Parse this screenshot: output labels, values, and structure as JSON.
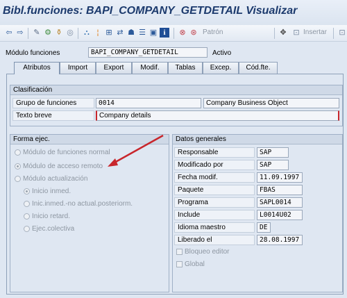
{
  "window": {
    "title": "Bibl.funciones: BAPI_COMPANY_GETDETAIL Visualizar"
  },
  "toolbar": {
    "buttons": [
      "back",
      "forward",
      "display-change",
      "other-object",
      "where-used",
      "activate",
      "test",
      "pattern",
      "navigate",
      "enhancement",
      "display-object-list",
      "info",
      "delete",
      "check"
    ],
    "pattern_label": "Patrón",
    "insert_label": "Insertar"
  },
  "header": {
    "module_label": "Módulo funciones",
    "module_value": "BAPI_COMPANY_GETDETAIL",
    "status": "Activo"
  },
  "tabs": [
    "Atributos",
    "Import",
    "Export",
    "Modif.",
    "Tablas",
    "Excep.",
    "Cód.fte."
  ],
  "active_tab": "Atributos",
  "clasificacion": {
    "heading": "Clasificación",
    "group_label": "Grupo de funciones",
    "group_value": "0014",
    "group_desc": "Company Business Object",
    "short_text_label": "Texto breve",
    "short_text_value": "Company details"
  },
  "forma_ejec": {
    "heading": "Forma ejec.",
    "options": [
      {
        "label": "Módulo de funciones normal",
        "selected": false
      },
      {
        "label": "Módulo de acceso remoto",
        "selected": true
      },
      {
        "label": "Módulo actualización",
        "selected": false
      }
    ],
    "sub_options": [
      {
        "label": "Inicio inmed.",
        "selected": true
      },
      {
        "label": "Inic.inmed.-no actual.posteriorm.",
        "selected": false
      },
      {
        "label": "Inicio retard.",
        "selected": false
      },
      {
        "label": "Ejec.colectiva",
        "selected": false
      }
    ]
  },
  "datos_generales": {
    "heading": "Datos generales",
    "rows": [
      {
        "label": "Responsable",
        "value": "SAP"
      },
      {
        "label": "Modificado por",
        "value": "SAP"
      },
      {
        "label": "Fecha modif.",
        "value": "11.09.1997"
      },
      {
        "label": "Paquete",
        "value": "FBAS"
      },
      {
        "label": "Programa",
        "value": "SAPL0014"
      },
      {
        "label": "Include",
        "value": "L0014U02"
      },
      {
        "label": "Idioma maestro",
        "value": "DE"
      },
      {
        "label": "Liberado el",
        "value": "28.08.1997"
      }
    ],
    "checkboxes": [
      {
        "label": "Bloqueo editor",
        "checked": false
      },
      {
        "label": "Global",
        "checked": false
      }
    ]
  },
  "colors": {
    "annotation_arrow": "#c8262c",
    "title": "#1c3a6d"
  }
}
